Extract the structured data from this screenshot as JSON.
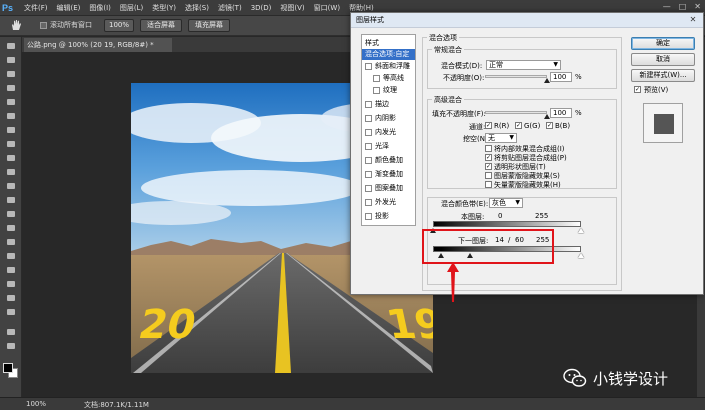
{
  "app": {
    "logo": "Ps",
    "menu": [
      "文件(F)",
      "编辑(E)",
      "图像(I)",
      "图层(L)",
      "类型(Y)",
      "选择(S)",
      "滤镜(T)",
      "3D(D)",
      "视图(V)",
      "窗口(W)",
      "帮助(H)"
    ],
    "window_controls": [
      "—",
      "□",
      "✕"
    ]
  },
  "options_bar": {
    "scroll_all_label": "滚动所有窗口",
    "zoom_btn": "100%",
    "fit_screen_btn": "适合屏幕",
    "fill_screen_btn": "填充屏幕"
  },
  "document": {
    "tab_title": "公路.png @ 100% (20 19, RGB/8#) *"
  },
  "status": {
    "zoom": "100%",
    "doc_info": "文档:807.1K/1.11M"
  },
  "dialog": {
    "title": "图层样式",
    "close": "✕",
    "styles_header": "样式",
    "styles": [
      {
        "label": "混合选项:自定",
        "checkbox": false,
        "active": true
      },
      {
        "label": "斜面和浮雕",
        "checkbox": true,
        "checked": false
      },
      {
        "label": "等高线",
        "checkbox": true,
        "checked": false,
        "indent": true
      },
      {
        "label": "纹理",
        "checkbox": true,
        "checked": false,
        "indent": true
      },
      {
        "label": "描边",
        "checkbox": true,
        "checked": false
      },
      {
        "label": "内阴影",
        "checkbox": true,
        "checked": false
      },
      {
        "label": "内发光",
        "checkbox": true,
        "checked": false
      },
      {
        "label": "光泽",
        "checkbox": true,
        "checked": false
      },
      {
        "label": "颜色叠加",
        "checkbox": true,
        "checked": false
      },
      {
        "label": "渐变叠加",
        "checkbox": true,
        "checked": false
      },
      {
        "label": "图案叠加",
        "checkbox": true,
        "checked": false
      },
      {
        "label": "外发光",
        "checkbox": true,
        "checked": false
      },
      {
        "label": "投影",
        "checkbox": true,
        "checked": false
      }
    ],
    "blending_options_title": "混合选项",
    "general_title": "常规混合",
    "blend_mode_label": "混合模式(D):",
    "blend_mode_value": "正常",
    "opacity_label": "不透明度(O):",
    "opacity_value": "100",
    "opacity_unit": "%",
    "opacity_level": 100,
    "advanced_title": "高级混合",
    "fill_opacity_label": "填充不透明度(F):",
    "fill_opacity_value": "100",
    "fill_opacity_unit": "%",
    "fill_opacity_level": 100,
    "channels_label": "通道:",
    "channels": [
      {
        "label": "R(R)",
        "checked": true
      },
      {
        "label": "G(G)",
        "checked": true
      },
      {
        "label": "B(B)",
        "checked": true
      }
    ],
    "knockout_label": "挖空(N):",
    "knockout_value": "无",
    "advanced_checks": [
      {
        "label": "将内部效果混合成组(I)",
        "checked": false
      },
      {
        "label": "将剪贴图层混合成组(P)",
        "checked": true
      },
      {
        "label": "透明形状图层(T)",
        "checked": true
      },
      {
        "label": "图层蒙版隐藏效果(S)",
        "checked": false
      },
      {
        "label": "矢量蒙版隐藏效果(H)",
        "checked": false
      }
    ],
    "blend_if_label": "混合颜色带(E):",
    "blend_if_value": "灰色",
    "this_layer_label": "本图层:",
    "this_layer_low": "0",
    "this_layer_high": "255",
    "underlying_label": "下一图层:",
    "underlying_low_a": "14",
    "underlying_slash": "/",
    "underlying_low_b": "60",
    "underlying_high": "255",
    "buttons": {
      "ok": "确定",
      "cancel": "取消",
      "new_style": "新建样式(W)...",
      "preview": "预览(V)"
    },
    "preview_checked": true
  },
  "watermark": {
    "text": "小钱学设计"
  },
  "colors": {
    "accent": "#3470c8",
    "annotation_red": "#e0141a",
    "ps_blue": "#5ab4ff"
  }
}
